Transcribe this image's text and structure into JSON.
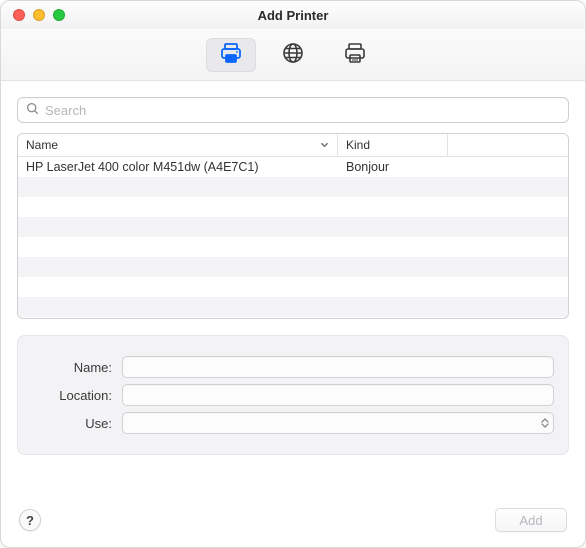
{
  "window": {
    "title": "Add Printer"
  },
  "toolbar": {
    "tabs": [
      {
        "name": "default-printer",
        "selected": true
      },
      {
        "name": "ip-printer",
        "selected": false
      },
      {
        "name": "windows-printer",
        "selected": false
      }
    ]
  },
  "search": {
    "placeholder": "Search",
    "value": ""
  },
  "columns": {
    "name": "Name",
    "kind": "Kind"
  },
  "rows": [
    {
      "name": "HP LaserJet 400 color M451dw (A4E7C1)",
      "kind": "Bonjour"
    }
  ],
  "form": {
    "name": {
      "label": "Name:",
      "value": ""
    },
    "location": {
      "label": "Location:",
      "value": ""
    },
    "use": {
      "label": "Use:",
      "value": ""
    }
  },
  "footer": {
    "help_label": "?",
    "add_label": "Add",
    "add_enabled": false
  }
}
